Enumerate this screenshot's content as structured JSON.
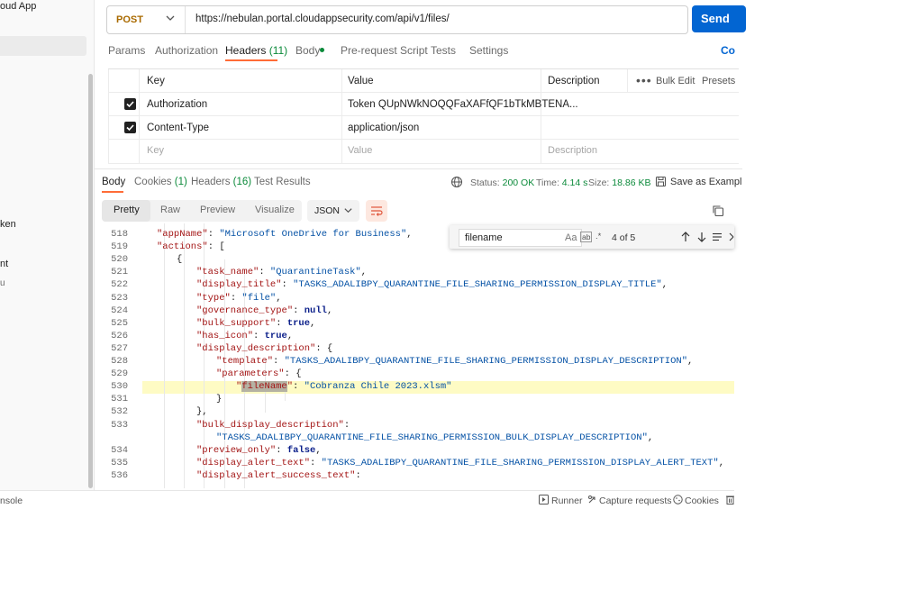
{
  "sidebar": {
    "items": [
      {
        "label": "oud App"
      },
      {
        "label": "ken"
      },
      {
        "label": "nt"
      },
      {
        "label": "u"
      }
    ]
  },
  "request": {
    "method": "POST",
    "url": "https://nebulan.portal.cloudappsecurity.com/api/v1/files/",
    "send_label": "Send",
    "tabs": [
      {
        "label": "Params"
      },
      {
        "label": "Authorization"
      },
      {
        "label": "Headers",
        "count": "(11)"
      },
      {
        "label": "Body"
      },
      {
        "label": "Pre-request Script"
      },
      {
        "label": "Tests"
      },
      {
        "label": "Settings"
      }
    ],
    "code_link": "Co"
  },
  "headers_table": {
    "columns": [
      "Key",
      "Value",
      "Description"
    ],
    "bulk_edit": "Bulk Edit",
    "presets": "Presets",
    "rows": [
      {
        "key": "Authorization",
        "value": "Token QUpNWkNOQQFaXAFfQF1bTkMBTENA...",
        "checked": true
      },
      {
        "key": "Content-Type",
        "value": "application/json",
        "checked": true
      }
    ],
    "placeholder": {
      "key": "Key",
      "value": "Value",
      "description": "Description"
    }
  },
  "response": {
    "tabs": [
      {
        "label": "Body"
      },
      {
        "label": "Cookies",
        "count": "(1)"
      },
      {
        "label": "Headers",
        "count": "(16)"
      },
      {
        "label": "Test Results"
      }
    ],
    "status_label": "Status:",
    "status_value": "200 OK",
    "time_label": "Time:",
    "time_value": "4.14 s",
    "size_label": "Size:",
    "size_value": "18.86 KB",
    "save_label": "Save as Exampl",
    "view_tabs": [
      "Pretty",
      "Raw",
      "Preview",
      "Visualize"
    ],
    "format": "JSON"
  },
  "find": {
    "query": "filename",
    "opt_case": "Aa",
    "opt_word": "ab",
    "opt_regex": ".*",
    "result": "4 of 5"
  },
  "code": {
    "line_numbers": [
      "518",
      "519",
      "520",
      "521",
      "522",
      "523",
      "524",
      "525",
      "526",
      "527",
      "528",
      "529",
      "530",
      "531",
      "532",
      "533",
      "",
      "534",
      "535",
      "536"
    ],
    "lines": [
      {
        "k": "\"appName\"",
        "p": ": ",
        "v": "\"Microsoft OneDrive for Business\"",
        "t": ","
      },
      {
        "k": "\"actions\"",
        "p": ": [",
        "v": "",
        "t": ""
      },
      {
        "k": "",
        "p": "{",
        "v": "",
        "t": ""
      },
      {
        "k": "\"task_name\"",
        "p": ": ",
        "v": "\"QuarantineTask\"",
        "t": ","
      },
      {
        "k": "\"display_title\"",
        "p": ": ",
        "v": "\"TASKS_ADALIBPY_QUARANTINE_FILE_SHARING_PERMISSION_DISPLAY_TITLE\"",
        "t": ","
      },
      {
        "k": "\"type\"",
        "p": ": ",
        "v": "\"file\"",
        "t": ","
      },
      {
        "k": "\"governance_type\"",
        "p": ": ",
        "v": "null",
        "t": ","
      },
      {
        "k": "\"bulk_support\"",
        "p": ": ",
        "v": "true",
        "t": ","
      },
      {
        "k": "\"has_icon\"",
        "p": ": ",
        "v": "true",
        "t": ","
      },
      {
        "k": "\"display_description\"",
        "p": ": {",
        "v": "",
        "t": ""
      },
      {
        "k": "\"template\"",
        "p": ": ",
        "v": "\"TASKS_ADALIBPY_QUARANTINE_FILE_SHARING_PERMISSION_DISPLAY_DESCRIPTION\"",
        "t": ","
      },
      {
        "k": "\"parameters\"",
        "p": ": {",
        "v": "",
        "t": ""
      },
      {
        "k": "\"fileName\"",
        "p": ": ",
        "v": "\"Cobranza Chile 2023.xlsm\"",
        "t": ""
      },
      {
        "k": "",
        "p": "}",
        "v": "",
        "t": ""
      },
      {
        "k": "",
        "p": "},",
        "v": "",
        "t": ""
      },
      {
        "k": "\"bulk_display_description\"",
        "p": ":",
        "v": "",
        "t": ""
      },
      {
        "k": "",
        "p": "",
        "v": "\"TASKS_ADALIBPY_QUARANTINE_FILE_SHARING_PERMISSION_BULK_DISPLAY_DESCRIPTION\"",
        "t": ","
      },
      {
        "k": "\"preview_only\"",
        "p": ": ",
        "v": "false",
        "t": ","
      },
      {
        "k": "\"display_alert_text\"",
        "p": ": ",
        "v": "\"TASKS_ADALIBPY_QUARANTINE_FILE_SHARING_PERMISSION_DISPLAY_ALERT_TEXT\"",
        "t": ","
      },
      {
        "k": "\"display_alert_success_text\"",
        "p": ":",
        "v": "",
        "t": ""
      }
    ]
  },
  "footer": {
    "console": "nsole",
    "runner": "Runner",
    "capture": "Capture requests",
    "cookies": "Cookies"
  },
  "colors": {
    "accent": "#ff6c37",
    "send": "#0265d2",
    "status_ok": "#0b8a3a",
    "method": "#a96a00"
  }
}
